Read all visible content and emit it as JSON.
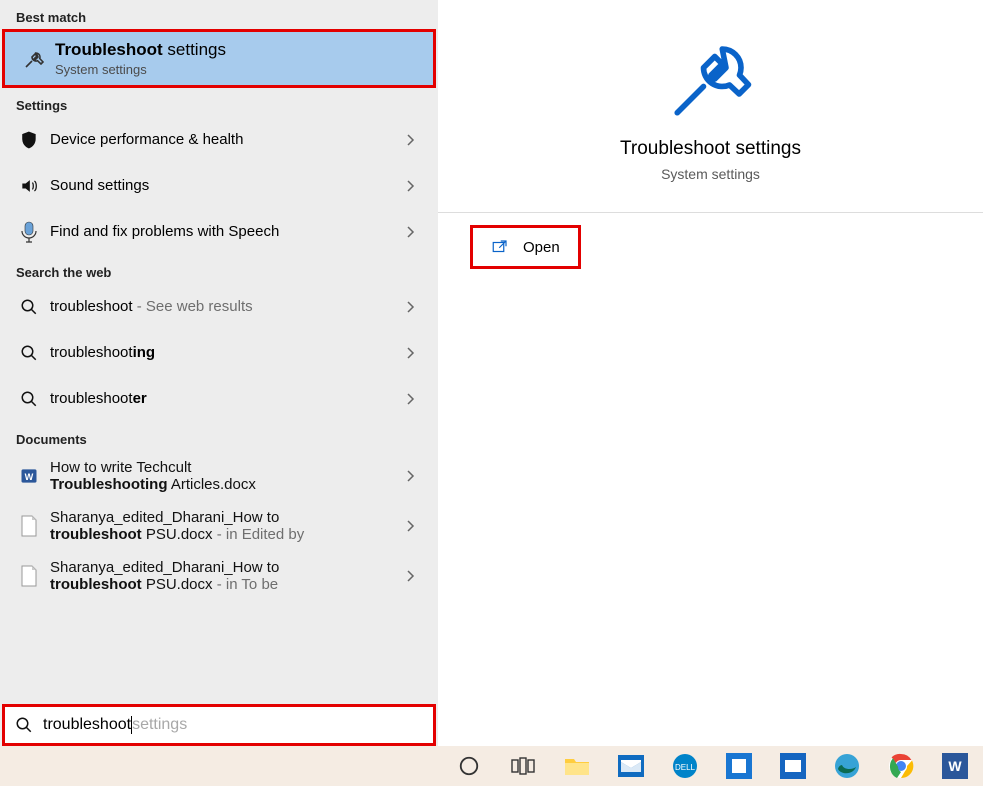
{
  "sections": {
    "best_match": "Best match",
    "settings": "Settings",
    "search_web": "Search the web",
    "documents": "Documents"
  },
  "best": {
    "title_a": "Troubleshoot",
    "title_b": " settings",
    "subtitle": "System settings"
  },
  "settings_items": [
    {
      "label": "Device performance & health",
      "icon": "shield"
    },
    {
      "label": "Sound settings",
      "icon": "speaker"
    },
    {
      "label": "Find and fix problems with Speech",
      "icon": "mic"
    }
  ],
  "web_items": [
    {
      "pre": "troubleshoot",
      "bold": "",
      "tail": " - See web results"
    },
    {
      "pre": "troubleshoot",
      "bold": "ing",
      "tail": ""
    },
    {
      "pre": "troubleshoot",
      "bold": "er",
      "tail": ""
    }
  ],
  "doc_items": [
    {
      "line1": "How to write Techcult",
      "line2_a": "Troubleshooting",
      "line2_b": " Articles.docx",
      "tail": "",
      "icon": "word"
    },
    {
      "line1": "Sharanya_edited_Dharani_How to",
      "line2_a": "troubleshoot",
      "line2_b": " PSU.docx",
      "tail": " - in Edited by",
      "icon": "file"
    },
    {
      "line1": "Sharanya_edited_Dharani_How to",
      "line2_a": "troubleshoot",
      "line2_b": " PSU.docx",
      "tail": " - in To be",
      "icon": "file"
    }
  ],
  "right": {
    "title": "Troubleshoot settings",
    "subtitle": "System settings",
    "open": "Open"
  },
  "search": {
    "typed": "troubleshoot",
    "ghost": " settings"
  }
}
